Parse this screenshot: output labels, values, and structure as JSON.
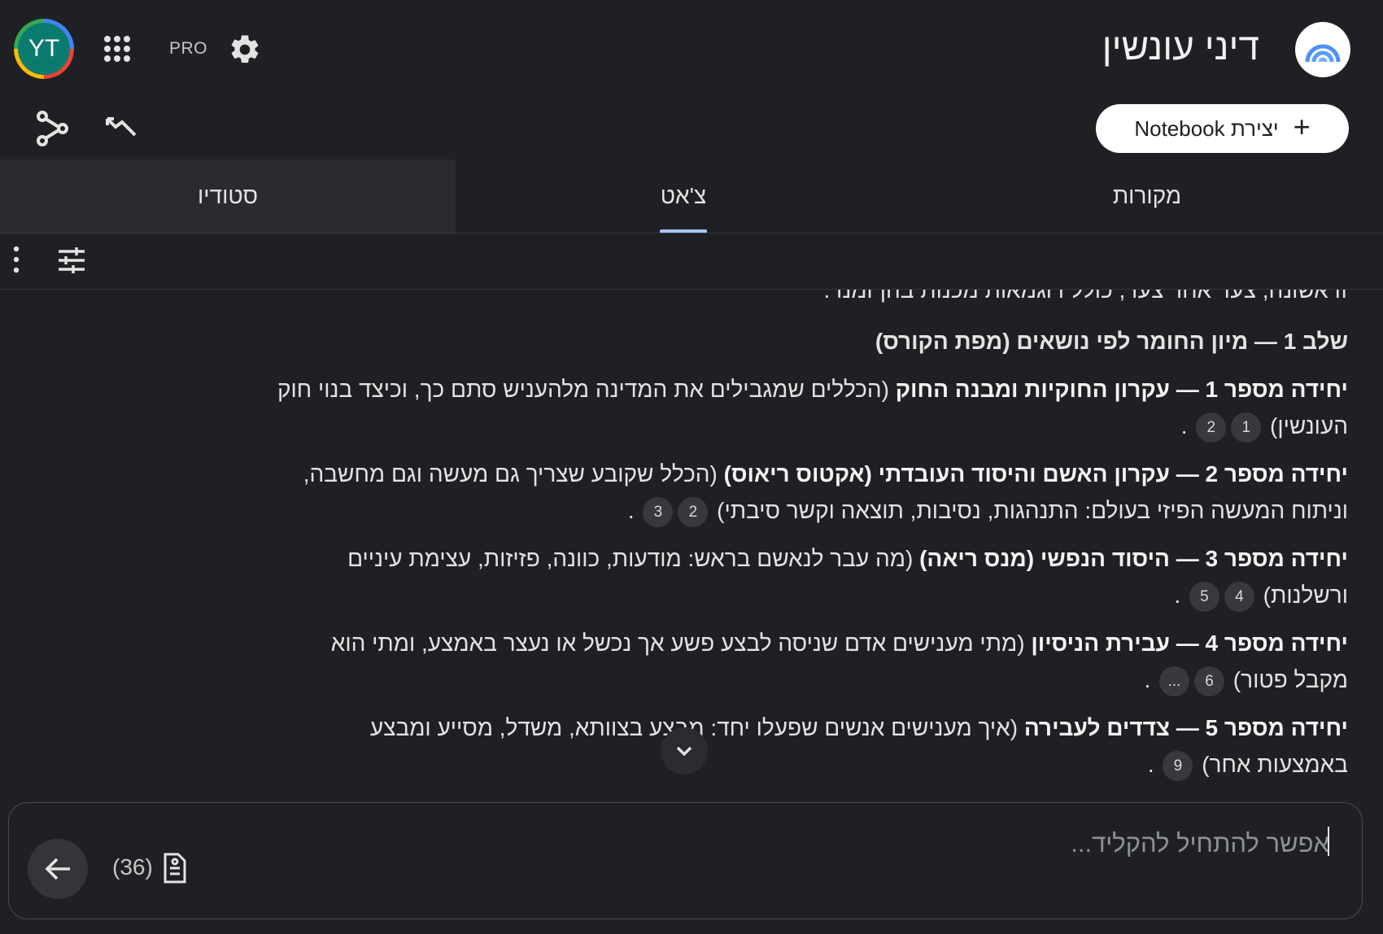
{
  "header": {
    "avatar_initials": "YT",
    "pro_label": "PRO",
    "notebook_title": "דיני עונשין",
    "create_button_label": "יצירת Notebook",
    "create_button_icon": "+"
  },
  "tabs": [
    {
      "label": "סטודיו",
      "active": false
    },
    {
      "label": "צ'אט",
      "active": true
    },
    {
      "label": "מקורות",
      "active": false
    }
  ],
  "chat": {
    "partial_line": "זו אשונה, צעד אחר צעד, כולל דוגמאות מכנות בהן זמנו .",
    "heading": "שלב 1 — מיון החומר לפי נושאים (מפת הקורס)",
    "units": [
      {
        "title": "יחידה מספר 1 — עקרון החוקיות ומבנה החוק",
        "desc": "(הכללים שמגבילים את המדינה מלהעניש סתם כך, וכיצד בנוי חוק העונשין)",
        "cites": [
          "1",
          "2"
        ],
        "end": "."
      },
      {
        "title": "יחידה מספר 2 — עקרון האשם והיסוד העובדתי (אקטוס ריאוס)",
        "desc": "(הכלל שקובע שצריך גם מעשה וגם מחשבה, וניתוח המעשה הפיזי בעולם: התנהגות, נסיבות, תוצאה וקשר סיבתי)",
        "cites": [
          "2",
          "3"
        ],
        "end": "."
      },
      {
        "title": "יחידה מספר 3 — היסוד הנפשי (מנס ריאה)",
        "desc": "(מה עבר לנאשם בראש: מודעות, כוונה, פזיזות, עצימת עיניים ורשלנות)",
        "cites": [
          "4",
          "5"
        ],
        "end": "."
      },
      {
        "title": "יחידה מספר 4 — עבירת הניסיון",
        "desc": "(מתי מענישים אדם שניסה לבצע פשע אך נכשל או נעצר באמצע, ומתי הוא מקבל פטור)",
        "cites": [
          "6",
          "..."
        ],
        "end": "."
      },
      {
        "title": "יחידה מספר 5 — צדדים לעבירה",
        "desc": "(איך מענישים אנשים שפעלו יחד: מבצע בצוותא, משדל, מסייע ומבצע באמצעות אחר)",
        "cites": [
          "9"
        ],
        "end": "."
      }
    ]
  },
  "composer": {
    "placeholder": "אפשר להתחיל להקליד...",
    "source_count": "(36)"
  },
  "icons": {
    "apps": "apps-grid-icon",
    "settings": "gear-icon",
    "share": "share-icon",
    "analytics": "analytics-icon",
    "more": "more-vert-icon",
    "tune": "tune-icon",
    "scroll": "chevron-down-icon",
    "send": "arrow-left-icon",
    "source": "document-icon"
  },
  "colors": {
    "background": "#1f2024",
    "accent": "#a8c7fa",
    "text": "#e3e3e3"
  }
}
